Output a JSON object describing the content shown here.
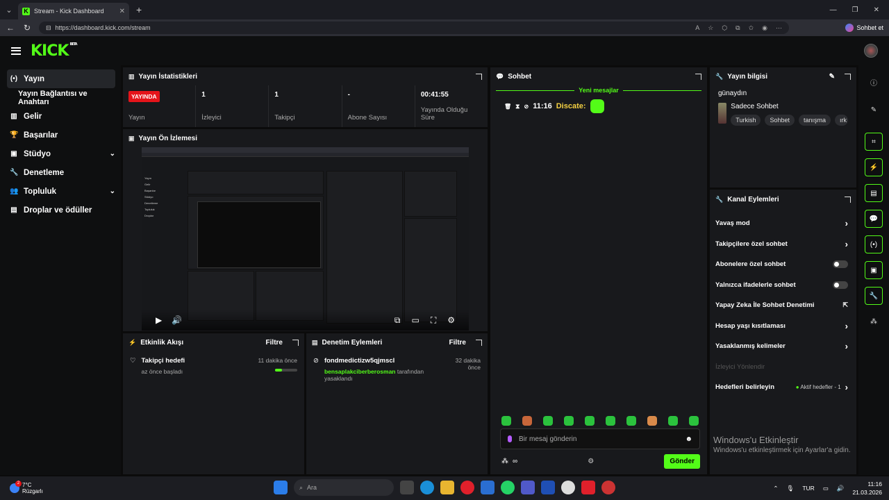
{
  "browser": {
    "tab_title": "Stream - Kick Dashboard",
    "url": "https://dashboard.kick.com/stream",
    "copilot_label": "Sohbet et"
  },
  "app": {
    "logo": "KICK",
    "beta": "BETA"
  },
  "sidebar": {
    "items": [
      {
        "label": "Yayın",
        "icon": "broadcast-icon",
        "active": true
      },
      {
        "label": "Yayın Bağlantısı ve Anahtarı",
        "icon": "",
        "sub": true
      },
      {
        "label": "Gelir",
        "icon": "chart-icon"
      },
      {
        "label": "Başarılar",
        "icon": "trophy-icon"
      },
      {
        "label": "Stüdyo",
        "icon": "studio-icon",
        "chevron": true
      },
      {
        "label": "Denetleme",
        "icon": "wrench-icon"
      },
      {
        "label": "Topluluk",
        "icon": "community-icon",
        "chevron": true
      },
      {
        "label": "Droplar ve ödüller",
        "icon": "gift-icon"
      }
    ]
  },
  "stats": {
    "title": "Yayın İstatistikleri",
    "items": [
      {
        "value": "YAYINDA",
        "label": "Yayın"
      },
      {
        "value": "1",
        "label": "İzleyici"
      },
      {
        "value": "1",
        "label": "Takipçi"
      },
      {
        "value": "-",
        "label": "Abone Sayısı"
      },
      {
        "value": "00:41:55",
        "label": "Yayında Olduğu Süre"
      }
    ]
  },
  "preview": {
    "title": "Yayın Ön İzlemesi"
  },
  "activity": {
    "title": "Etkinlik Akışı",
    "filter": "Filtre",
    "item_title": "Takipçi hedefi",
    "item_sub": "az önce başladı",
    "item_time": "11 dakika önce",
    "progress": 0.3
  },
  "moderation": {
    "title": "Denetim Eylemleri",
    "filter": "Filtre",
    "item_title": "fondmedictizw5qjmscl",
    "item_time": "32 dakika önce",
    "item_by": "bensaplakciberberosman",
    "item_suffix": "tarafından yasaklandı"
  },
  "chat": {
    "title": "Sohbet",
    "new_messages": "Yeni mesajlar",
    "msg_time": "11:16",
    "msg_user": "Discate:",
    "placeholder": "Bir mesaj gönderin",
    "send": "Gönder",
    "inf": "∞"
  },
  "info": {
    "title": "Yayın bilgisi",
    "stream_title": "günaydın",
    "category": "Sadece Sohbet",
    "tags": [
      "Turkish",
      "Sohbet",
      "tanışma",
      "ırk"
    ]
  },
  "channel": {
    "title": "Kanal Eylemleri",
    "rows": [
      {
        "label": "Yavaş mod",
        "type": "arrow"
      },
      {
        "label": "Takipçilere özel sohbet",
        "type": "arrow"
      },
      {
        "label": "Abonelere özel sohbet",
        "type": "toggle"
      },
      {
        "label": "Yalnızca ifadelerle sohbet",
        "type": "toggle"
      },
      {
        "label": "Yapay Zeka İle Sohbet Denetimi",
        "type": "ext"
      },
      {
        "label": "Hesap yaşı kısıtlaması",
        "type": "arrow"
      },
      {
        "label": "Yasaklanmış kelimeler",
        "type": "arrow"
      },
      {
        "label": "İzleyici Yönlendir",
        "type": "dim"
      },
      {
        "label": "Hedefleri belirleyin",
        "type": "goal",
        "extra": "Aktif hedefler - 1"
      }
    ]
  },
  "watermark": {
    "line1": "Windows'u Etkinleştir",
    "line2": "Windows'u etkinleştirmek için Ayarlar'a gidin."
  },
  "taskbar": {
    "temp": "7°C",
    "weather": "Rüzgarlı",
    "search": "Ara",
    "lang": "TUR",
    "time": "11:16",
    "date": "21.03.2026",
    "badge": "2"
  }
}
